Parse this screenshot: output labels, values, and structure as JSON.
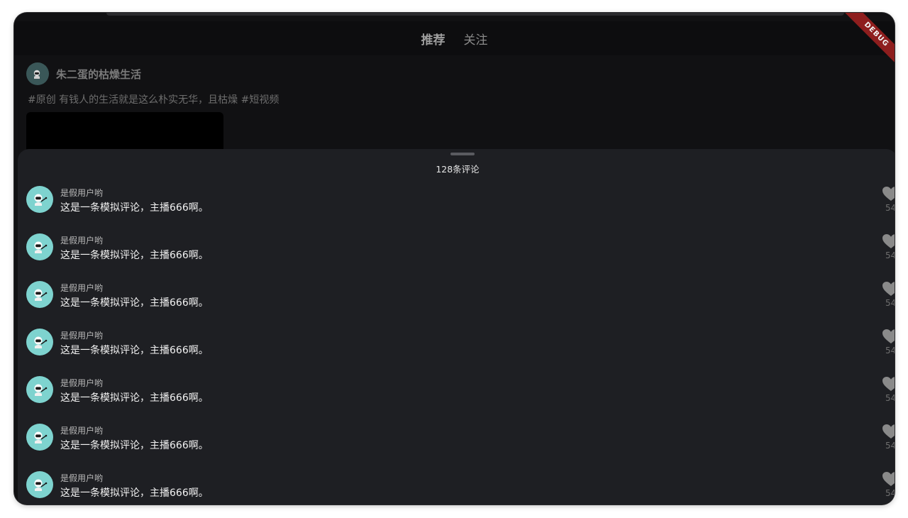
{
  "header": {
    "tabs": [
      {
        "label": "推荐",
        "active": true
      },
      {
        "label": "关注",
        "active": false
      }
    ],
    "debug_banner": "DEBUG"
  },
  "feed": {
    "author": "朱二蛋的枯燥生活",
    "description": "#原创 有钱人的生活就是这么朴实无华，且枯燥 #短视频"
  },
  "comments_sheet": {
    "title": "128条评论",
    "items": [
      {
        "user": "是假用户哟",
        "text": "这是一条模拟评论，主播666啊。",
        "likes": "54"
      },
      {
        "user": "是假用户哟",
        "text": "这是一条模拟评论，主播666啊。",
        "likes": "54"
      },
      {
        "user": "是假用户哟",
        "text": "这是一条模拟评论，主播666啊。",
        "likes": "54"
      },
      {
        "user": "是假用户哟",
        "text": "这是一条模拟评论，主播666啊。",
        "likes": "54"
      },
      {
        "user": "是假用户哟",
        "text": "这是一条模拟评论，主播666啊。",
        "likes": "54"
      },
      {
        "user": "是假用户哟",
        "text": "这是一条模拟评论，主播666啊。",
        "likes": "54"
      },
      {
        "user": "是假用户哟",
        "text": "这是一条模拟评论，主播666啊。",
        "likes": "54"
      }
    ]
  },
  "icons": {
    "avatar": "astronaut-avatar-icon",
    "like": "heart-icon"
  },
  "colors": {
    "background": "#111113",
    "sheet": "#1e1f23",
    "avatar_bg": "#7ed3cf",
    "debug_ribbon": "#8e1e1e",
    "like_icon": "#8a8a8a"
  }
}
